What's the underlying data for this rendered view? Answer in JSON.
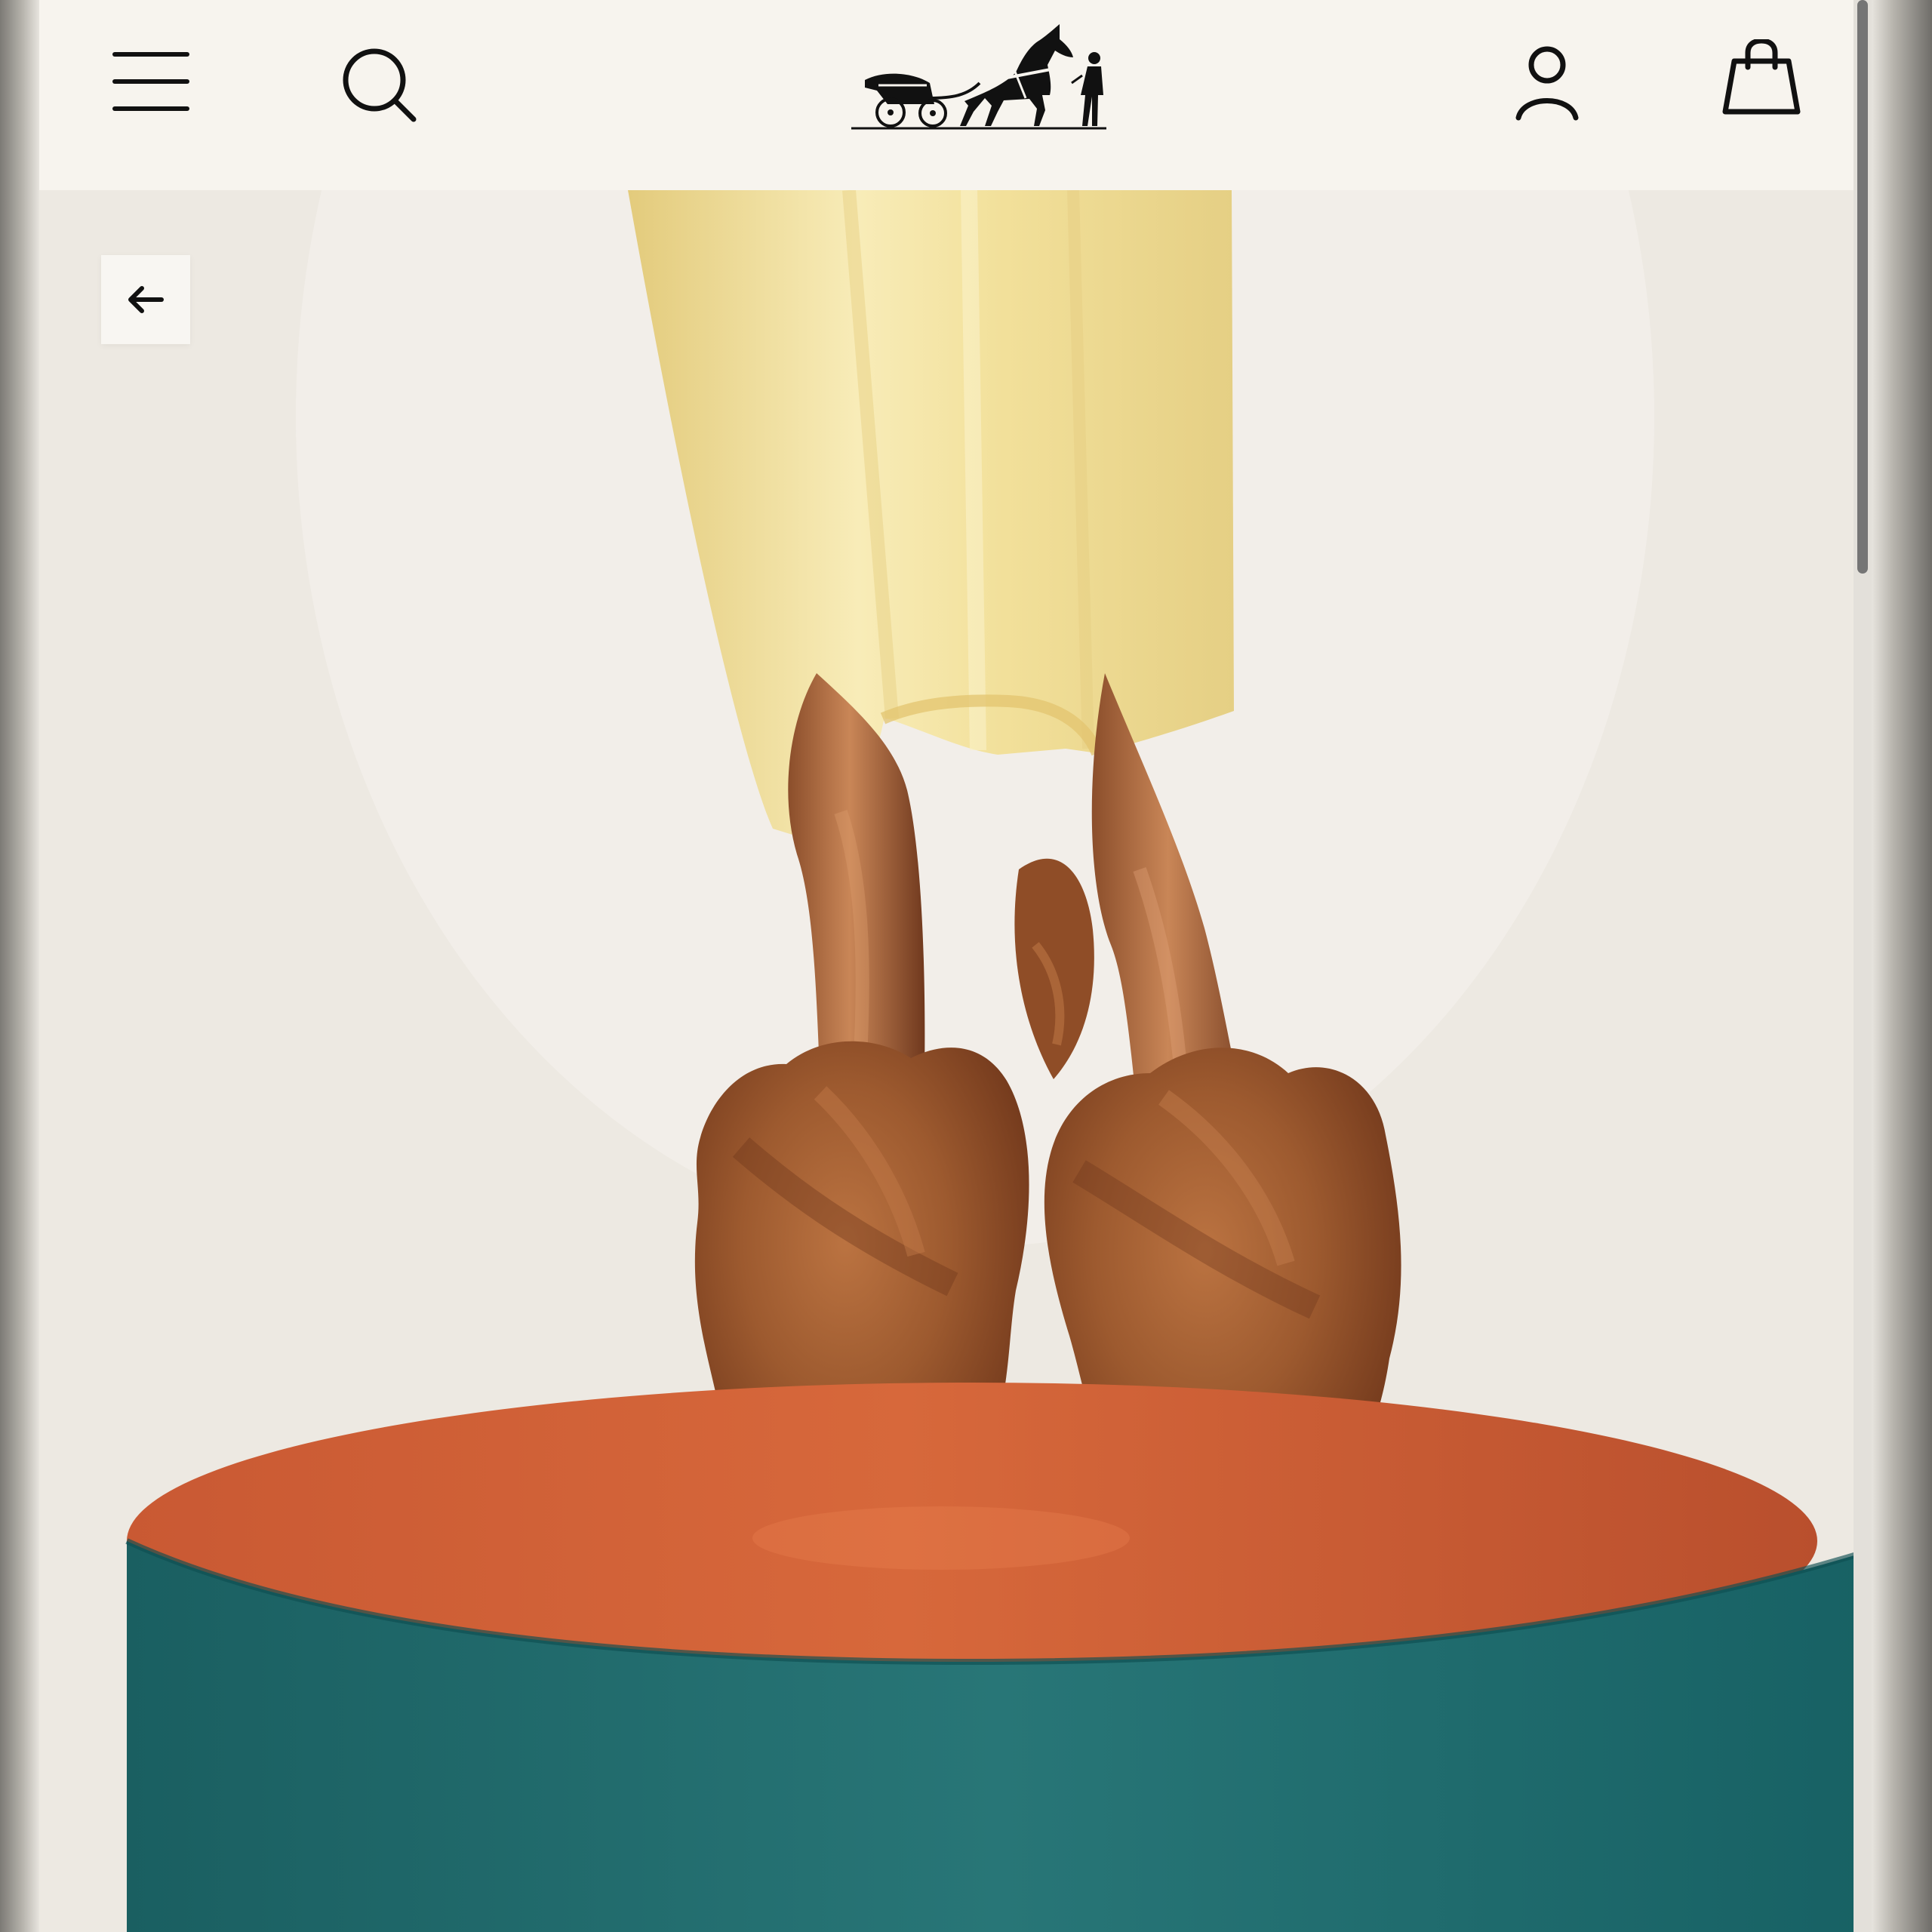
{
  "header": {
    "icons": [
      {
        "name": "menu-icon"
      },
      {
        "name": "search-icon"
      },
      {
        "name": "carriage-logo"
      },
      {
        "name": "account-icon"
      },
      {
        "name": "shopping-bag-icon"
      }
    ]
  },
  "navigation": {
    "back_icon": "arrow-left-icon"
  },
  "colors": {
    "header_bg": "#f7f4ee",
    "icon_stroke": "#111111",
    "background": "#efece6",
    "skirt": "#f1e2a1",
    "fur": "#9d5a2f",
    "pedestal_top": "#c85d36",
    "pedestal_body": "#1e6d6d"
  }
}
